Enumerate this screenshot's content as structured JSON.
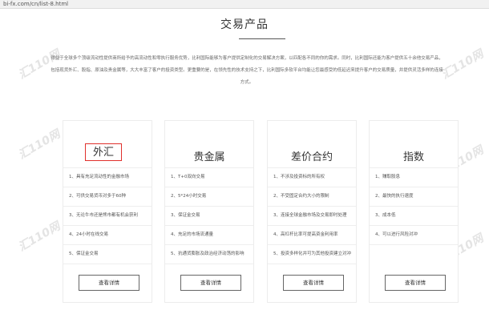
{
  "browser": {
    "url": "bi-fx.com/cn/list-8.html"
  },
  "page": {
    "title": "交易产品",
    "description": "得益于全球多个顶级流动性提供商所给予的高流动性和零执行服务优势，比利国际能够为客户提供定制化的交易解决方案，以匹配各不同的你的需求。同时，比利国际还能为客户提供五十余他交易产品，包括现货外汇、股指、原油及贵金属等，大大丰富了客户的投资类型。更重要的是，在领先性的技术支持之下，比利国际多软平台均能让您最感受的低延迟来提升客户的交易质量，并提供灵活多样的连接方式。"
  },
  "watermark": "汇110网",
  "cards": [
    {
      "title": "外汇",
      "highlighted": true,
      "items": [
        "1、具有充足流动性的金融市场",
        "2、可供交易货币对多于60种",
        "3、无论牛市还是熊市都有机会获利",
        "4、24小时在线交易",
        "5、保证金交易"
      ],
      "button": "查看详情"
    },
    {
      "title": "贵金属",
      "highlighted": false,
      "items": [
        "1、T+0双向交易",
        "2、5*24小时交易",
        "3、保证金交易",
        "4、充足的市场流通量",
        "5、抗通货膨胀及政治经济动荡的影响"
      ],
      "button": "查看详情"
    },
    {
      "title": "差价合约",
      "highlighted": false,
      "items": [
        "1、不涉及投资标的所有权",
        "2、不受固定合约大小的限制",
        "3、连接全球金融市场及交易即时处理",
        "4、高杠杆比率可提高资金利用率",
        "5、投资多样化并可为其他投资建立对冲"
      ],
      "button": "查看详情"
    },
    {
      "title": "指数",
      "highlighted": false,
      "items": [
        "1、赚取股息",
        "2、最快的执行速度",
        "3、成本低",
        "4、可以进行风险对冲"
      ],
      "button": "查看详情"
    }
  ],
  "colors": {
    "highlight_border": "#e0302c",
    "background": "#ffffff"
  }
}
